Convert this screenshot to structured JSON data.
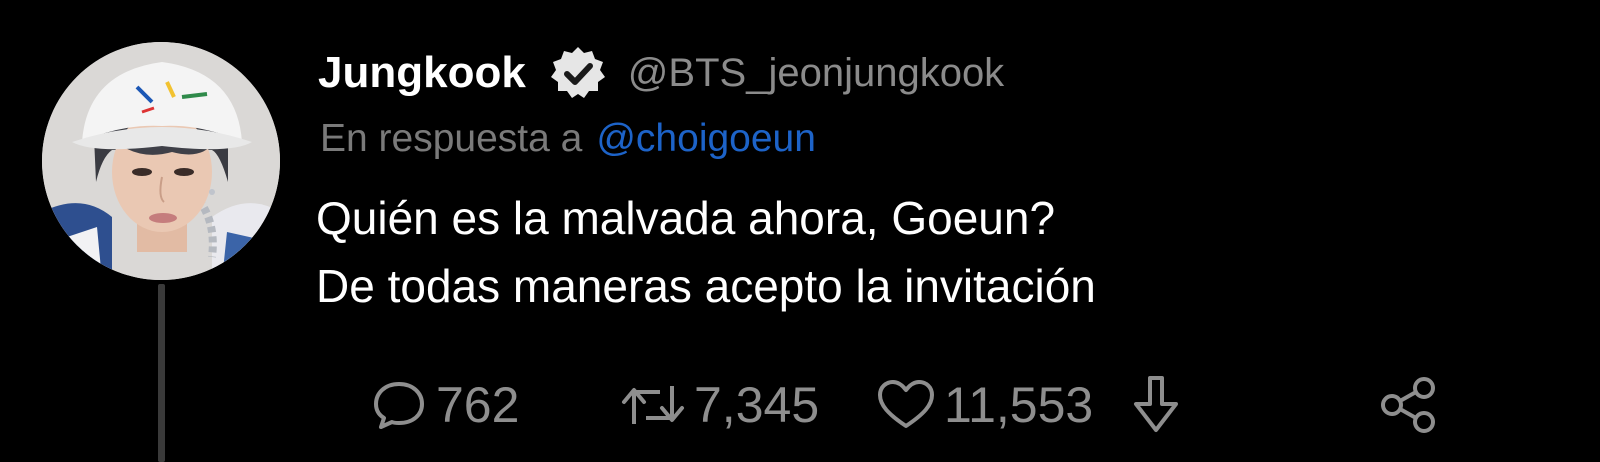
{
  "user": {
    "display_name": "Jungkook",
    "handle": "@BTS_jeonjungkook",
    "verified_icon": "verified-badge-icon",
    "avatar": "profile-photo"
  },
  "reply": {
    "prefix": "En respuesta a",
    "to_handle": "@choigoeun"
  },
  "tweet": {
    "lines": [
      "Quién es la malvada ahora, Goeun?",
      "De todas maneras acepto la invitación"
    ]
  },
  "actions": {
    "replies": {
      "icon": "comment-icon",
      "count": "762"
    },
    "retweets": {
      "icon": "retweet-icon",
      "count": "7,345"
    },
    "likes": {
      "icon": "heart-icon",
      "count": "11,553"
    },
    "download": {
      "icon": "download-arrow-icon"
    },
    "share": {
      "icon": "share-icon"
    }
  },
  "colors": {
    "background": "#000000",
    "name": "#ffffff",
    "muted": "#8b8b8b",
    "link": "#1d63c8",
    "thread_line": "#3a3a3a"
  }
}
